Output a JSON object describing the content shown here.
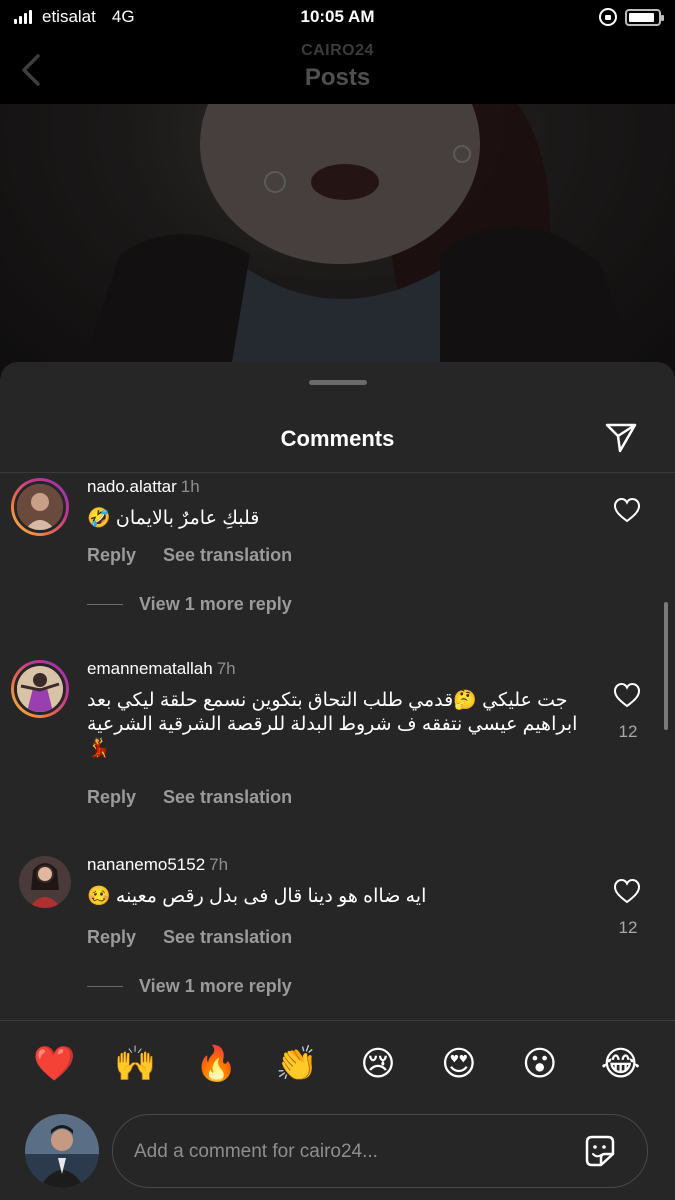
{
  "status_bar": {
    "carrier": "etisalat",
    "network": "4G",
    "time": "10:05 AM",
    "battery_level": 0.9
  },
  "header": {
    "subtitle": "CAIRO24",
    "title": "Posts"
  },
  "sheet": {
    "title": "Comments"
  },
  "comments": [
    {
      "username": "nado.alattar",
      "time": "1h",
      "text": "قلبكِ عامرٌ بالايمان 🤣",
      "reply_label": "Reply",
      "translate_label": "See translation",
      "more_replies": "View 1 more reply"
    },
    {
      "username": "emannematallah",
      "time": "7h",
      "text": "جت عليكي 🤔قدمي طلب التحاق بتكوين نسمع حلقة ليكي بعد ابراهيم عيسي نتفقه ف شروط البدلة للرقصة الشرقية الشرعية 💃",
      "reply_label": "Reply",
      "translate_label": "See translation",
      "likes": "12"
    },
    {
      "username": "nananemo5152",
      "time": "7h",
      "text": "ايه ضااه هو دينا قال فى بدل رقص معينه 🥴",
      "reply_label": "Reply",
      "translate_label": "See translation",
      "likes": "12",
      "more_replies": "View 1 more reply"
    }
  ],
  "reactions": [
    "❤️",
    "🙌",
    "🔥",
    "👏",
    "😢",
    "😍",
    "😮",
    "😂"
  ],
  "composer": {
    "placeholder": "Add a comment for cairo24..."
  },
  "colors": {
    "sheet_bg": "#262626",
    "muted_text": "#8e8e8e",
    "story_ring": "#c1358f"
  }
}
